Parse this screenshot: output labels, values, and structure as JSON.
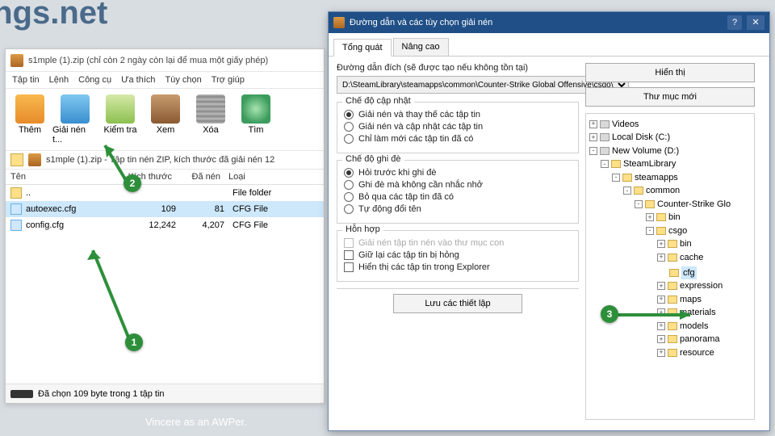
{
  "bg": {
    "brand": "ings.net",
    "caption": "Vincere as an AWPer."
  },
  "winrar": {
    "title": "s1mple (1).zip (chỉ còn 2 ngày còn lại để mua một giấy phép)",
    "menu": [
      "Tập tin",
      "Lệnh",
      "Công cụ",
      "Ưa thích",
      "Tùy chọn",
      "Trợ giúp"
    ],
    "tools": {
      "add": "Thêm",
      "extract": "Giải nén t...",
      "test": "Kiểm tra",
      "view": "Xem",
      "del": "Xóa",
      "find": "Tìm"
    },
    "path": "s1mple (1).zip - Tập tin nén ZIP, kích thước đã giải nén 12",
    "cols": {
      "name": "Tên",
      "size": "Kích thước",
      "packed": "Đã nén",
      "type": "Loại"
    },
    "rows": [
      {
        "name": "..",
        "type": "File folder"
      },
      {
        "name": "autoexec.cfg",
        "size": "109",
        "packed": "81",
        "type": "CFG File"
      },
      {
        "name": "config.cfg",
        "size": "12,242",
        "packed": "4,207",
        "type": "CFG File"
      }
    ],
    "status": "Đã chọn 109 byte trong 1 tập tin"
  },
  "dialog": {
    "title": "Đường dẫn và các tùy chọn giải nén",
    "tabs": {
      "general": "Tổng quát",
      "advanced": "Nâng cao"
    },
    "dest_label": "Đường dẫn đích (sẽ được tạo nếu không tồn tại)",
    "dest_value": "D:\\SteamLibrary\\steamapps\\common\\Counter-Strike Global Offensive\\csgo\\",
    "btn_show": "Hiển thị",
    "btn_newdir": "Thư mục mới",
    "btn_save": "Lưu các thiết lập",
    "grp_update": {
      "title": "Chế độ cập nhật",
      "o1": "Giải nén và thay thế các tập tin",
      "o2": "Giải nén và cập nhật các tập tin",
      "o3": "Chỉ làm mới các tập tin đã có"
    },
    "grp_over": {
      "title": "Chế độ ghi đè",
      "o1": "Hỏi trước khi ghi đè",
      "o2": "Ghi đè mà không cần nhắc nhở",
      "o3": "Bỏ qua các tập tin đã có",
      "o4": "Tự động đổi tên"
    },
    "grp_misc": {
      "title": "Hỗn hợp",
      "o1": "Giải nén tập tin nén vào thư mục con",
      "o2": "Giữ lại các tập tin bị hỏng",
      "o3": "Hiển thị các tập tin trong Explorer"
    },
    "tree": [
      {
        "d": 0,
        "pm": "+",
        "ico": "td",
        "label": "Videos"
      },
      {
        "d": 0,
        "pm": "+",
        "ico": "td",
        "label": "Local Disk (C:)"
      },
      {
        "d": 0,
        "pm": "-",
        "ico": "td",
        "label": "New Volume (D:)"
      },
      {
        "d": 1,
        "pm": "-",
        "ico": "tf",
        "label": "SteamLibrary"
      },
      {
        "d": 2,
        "pm": "-",
        "ico": "tf",
        "label": "steamapps"
      },
      {
        "d": 3,
        "pm": "-",
        "ico": "tf",
        "label": "common"
      },
      {
        "d": 4,
        "pm": "-",
        "ico": "tf",
        "label": "Counter-Strike Glo"
      },
      {
        "d": 5,
        "pm": "+",
        "ico": "tf",
        "label": "bin"
      },
      {
        "d": 5,
        "pm": "-",
        "ico": "tf",
        "label": "csgo"
      },
      {
        "d": 6,
        "pm": "+",
        "ico": "tf",
        "label": "bin"
      },
      {
        "d": 6,
        "pm": "+",
        "ico": "tf",
        "label": "cache"
      },
      {
        "d": 6,
        "pm": "",
        "ico": "tf",
        "label": "cfg",
        "sel": true
      },
      {
        "d": 6,
        "pm": "+",
        "ico": "tf",
        "label": "expression"
      },
      {
        "d": 6,
        "pm": "+",
        "ico": "tf",
        "label": "maps"
      },
      {
        "d": 6,
        "pm": "+",
        "ico": "tf",
        "label": "materials"
      },
      {
        "d": 6,
        "pm": "+",
        "ico": "tf",
        "label": "models"
      },
      {
        "d": 6,
        "pm": "+",
        "ico": "tf",
        "label": "panorama"
      },
      {
        "d": 6,
        "pm": "+",
        "ico": "tf",
        "label": "resource"
      }
    ]
  },
  "badges": {
    "b1": "1",
    "b2": "2",
    "b3": "3"
  }
}
